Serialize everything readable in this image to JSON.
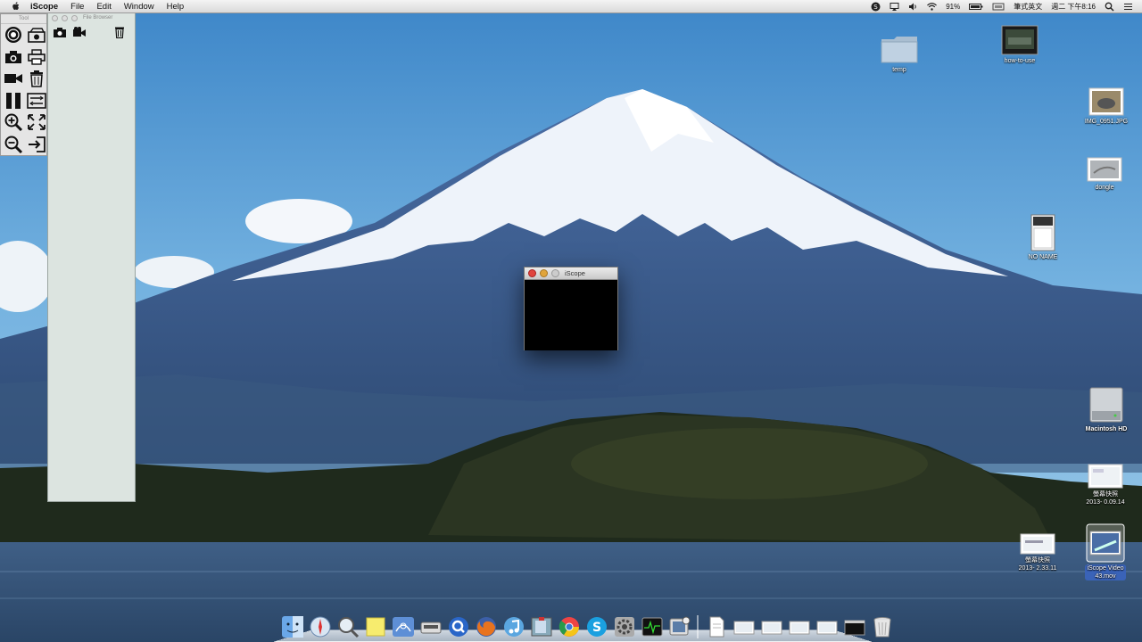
{
  "menubar": {
    "app_name": "iScope",
    "menus": [
      "File",
      "Edit",
      "Window",
      "Help"
    ],
    "battery": "91%",
    "input_method": "筆式英文",
    "clock": "週二 下午8:16"
  },
  "tool_palette": {
    "title": "Tool",
    "tools": [
      "target-icon",
      "photo-album-icon",
      "camera-icon",
      "printer-icon",
      "video-camera-icon",
      "trash-icon",
      "pause-icon",
      "settings-toggle-icon",
      "zoom-in-icon",
      "fullscreen-icon",
      "zoom-out-icon",
      "exit-icon"
    ]
  },
  "file_browser": {
    "title": "File Browser"
  },
  "iscope_window": {
    "title": "iScope"
  },
  "desktop_icons": [
    {
      "id": "temp",
      "label": "temp",
      "icon": "folder-icon"
    },
    {
      "id": "how-to-use",
      "label": "how-to-use",
      "icon": "video-file-icon"
    },
    {
      "id": "img",
      "label": "IMG_0951.JPG",
      "icon": "image-file-icon"
    },
    {
      "id": "dongle",
      "label": "dongle",
      "icon": "image-file-icon"
    },
    {
      "id": "noname",
      "label": "NO NAME",
      "icon": "sd-card-icon"
    },
    {
      "id": "hd",
      "label": "Macintosh HD",
      "icon": "hard-drive-icon"
    },
    {
      "id": "shot1",
      "label_line1": "螢幕快照",
      "label_line2": "2013-  0.09.14",
      "icon": "screenshot-file-icon"
    },
    {
      "id": "shot2",
      "label_line1": "螢幕快照",
      "label_line2": "2013-  2.33.11",
      "icon": "screenshot-file-icon"
    },
    {
      "id": "video",
      "label_line1": "iScope Video",
      "label_line2": "43.mov",
      "icon": "movie-file-icon"
    }
  ],
  "dock": {
    "apps": [
      "finder-icon",
      "safari-icon",
      "preview-icon",
      "stickies-icon",
      "network-icon",
      "scanner-icon",
      "quicktime-icon",
      "firefox-icon",
      "itunes-icon",
      "photo-booth-icon",
      "chrome-icon",
      "skype-icon",
      "system-preferences-icon",
      "activity-monitor-icon",
      "iscope-app-icon"
    ],
    "docs": [
      "document-icon",
      "stack-icon",
      "stack-icon",
      "stack-icon",
      "stack-icon",
      "terminal-icon",
      "trash-icon"
    ]
  }
}
